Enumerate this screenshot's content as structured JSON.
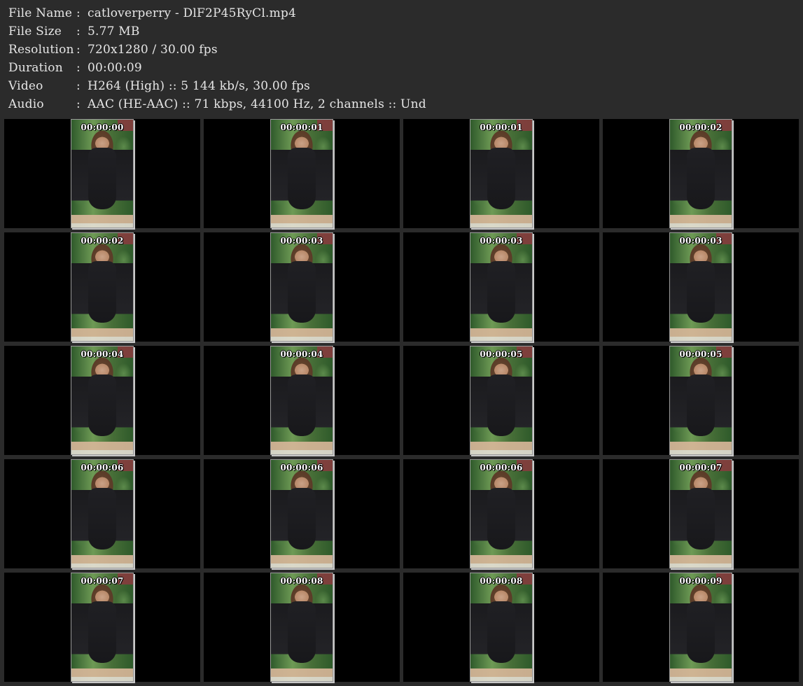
{
  "metadata": [
    {
      "key": "File Name",
      "sep": ":",
      "value": "catloverperry - DlF2P45RyCl.mp4"
    },
    {
      "key": "File Size",
      "sep": ":",
      "value": "5.77 MB"
    },
    {
      "key": "Resolution",
      "sep": ":",
      "value": "720x1280 / 30.00 fps"
    },
    {
      "key": "Duration",
      "sep": ":",
      "value": "00:00:09"
    },
    {
      "key": "Video",
      "sep": ":",
      "value": "H264 (High) :: 5 144 kb/s, 30.00 fps"
    },
    {
      "key": "Audio",
      "sep": ":",
      "value": "AAC (HE-AAC) :: 71 kbps, 44100 Hz, 2 channels :: Und"
    }
  ],
  "thumbnails": [
    {
      "time": "00:00:00"
    },
    {
      "time": "00:00:01"
    },
    {
      "time": "00:00:01"
    },
    {
      "time": "00:00:02"
    },
    {
      "time": "00:00:02"
    },
    {
      "time": "00:00:03"
    },
    {
      "time": "00:00:03"
    },
    {
      "time": "00:00:03"
    },
    {
      "time": "00:00:04"
    },
    {
      "time": "00:00:04"
    },
    {
      "time": "00:00:05"
    },
    {
      "time": "00:00:05"
    },
    {
      "time": "00:00:06"
    },
    {
      "time": "00:00:06"
    },
    {
      "time": "00:00:06"
    },
    {
      "time": "00:00:07"
    },
    {
      "time": "00:00:07"
    },
    {
      "time": "00:00:08"
    },
    {
      "time": "00:00:08"
    },
    {
      "time": "00:00:09"
    }
  ],
  "colors": {
    "background": "#2b2b2b",
    "cell_background": "#000000",
    "text": "#e6e6e6"
  }
}
